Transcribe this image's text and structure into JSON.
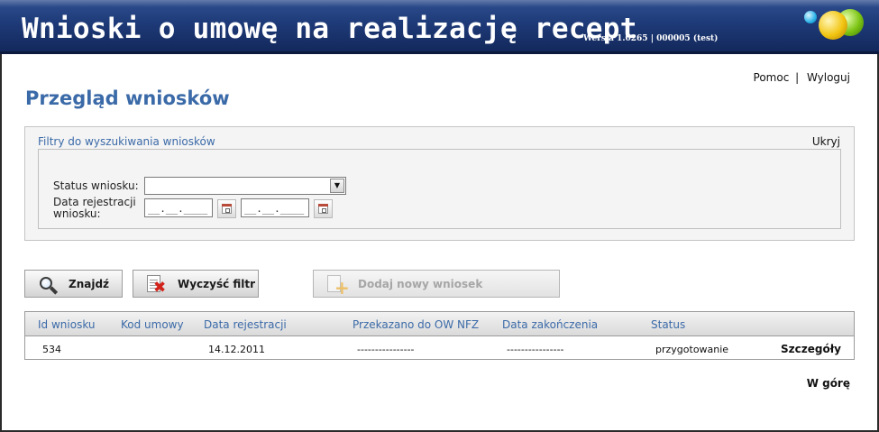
{
  "header": {
    "title": "Wnioski o umowę na realizację recept",
    "version": "Wersja 1.0265 | 000005 (test)"
  },
  "top_links": {
    "help": "Pomoc",
    "separator": "|",
    "logout": "Wyloguj"
  },
  "page_title": "Przegląd wniosków",
  "filters": {
    "heading": "Filtry do wyszukiwania wniosków",
    "hide_label": "Ukryj",
    "status_label": "Status wniosku:",
    "status_value": "",
    "date_label": "Data rejestracji wniosku:",
    "date_from": "__.__.____",
    "date_to": "__.__.____"
  },
  "buttons": {
    "find": "Znajdź",
    "clear": "Wyczyść filtr",
    "add": "Dodaj nowy wniosek"
  },
  "table": {
    "columns": [
      "Id wniosku",
      "Kod umowy",
      "Data rejestracji",
      "Przekazano do OW NFZ",
      "Data zakończenia",
      "Status"
    ],
    "rows": [
      {
        "id": "534",
        "kod_umowy": "",
        "data_rejestracji": "14.12.2011",
        "przekazano": "----------------",
        "data_zakonczenia": "----------------",
        "status": "przygotowanie",
        "action": "Szczegóły"
      }
    ]
  },
  "back_to_top": "W górę"
}
